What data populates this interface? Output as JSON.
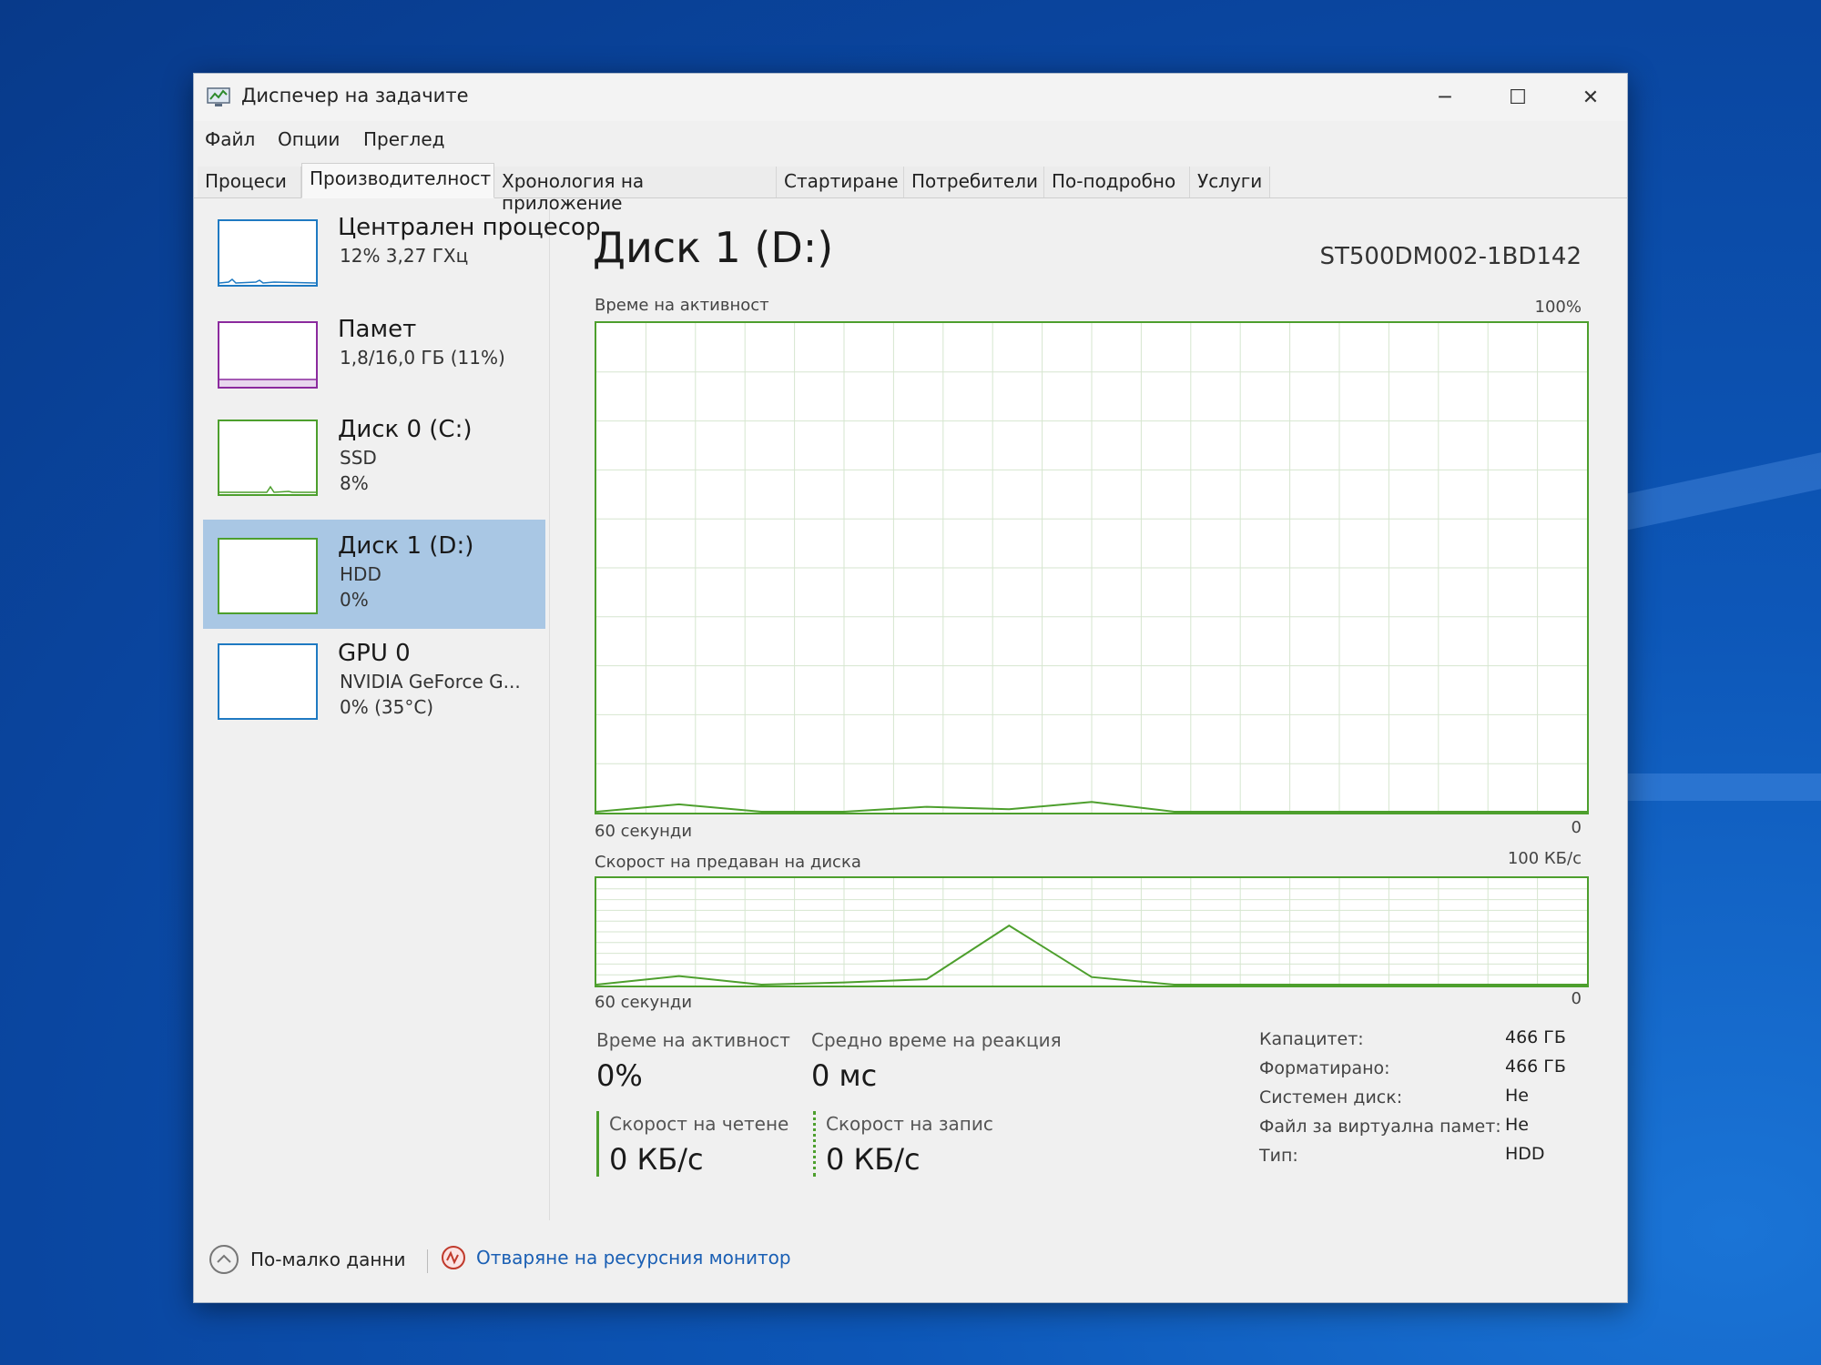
{
  "window": {
    "title": "Диспечер на задачите",
    "controls": {
      "minimize": "─",
      "maximize": "☐",
      "close": "✕"
    }
  },
  "menu": [
    "Файл",
    "Опции",
    "Преглед"
  ],
  "tabs": [
    "Процеси",
    "Производителност",
    "Хронология на приложение",
    "Стартиране",
    "Потребители",
    "По-подробно",
    "Услуги"
  ],
  "active_tab": "Производителност",
  "sidebar": {
    "items": [
      {
        "name": "Централен процеcор",
        "line1": "12% 3,27 ГХц",
        "line2": "",
        "color": "#1f7ac2"
      },
      {
        "name": "Памет",
        "line1": "1,8/16,0 ГБ (11%)",
        "line2": "",
        "color": "#8b2a9e"
      },
      {
        "name": "Диск 0 (C:)",
        "line1": "SSD",
        "line2": "8%",
        "color": "#4d9f2d"
      },
      {
        "name": "Диск 1 (D:)",
        "line1": "HDD",
        "line2": "0%",
        "color": "#4d9f2d"
      },
      {
        "name": "GPU 0",
        "line1": "NVIDIA GeForce G...",
        "line2": "0% (35°C)",
        "color": "#1f7ac2"
      }
    ],
    "selected_index": 3
  },
  "main": {
    "title": "Диск 1 (D:)",
    "model": "ST500DM002-1BD142",
    "activity_chart": {
      "label": "Време на активност",
      "max": "100%",
      "x_label": "60 секунди",
      "min": "0"
    },
    "transfer_chart": {
      "label": "Скорост на предаван на диска",
      "max": "100 КБ/с",
      "x_label": "60 секунди",
      "min": "0"
    },
    "stats": {
      "active_time_label": "Време на активност",
      "active_time_value": "0%",
      "response_label": "Средно време на реакция",
      "response_value": "0 мс",
      "read_label": "Скорост на четене",
      "read_value": "0 КБ/с",
      "write_label": "Скорост на запис",
      "write_value": "0 КБ/с"
    },
    "info": [
      {
        "label": "Капацитет:",
        "value": "466 ГБ"
      },
      {
        "label": "Форматирано:",
        "value": "466 ГБ"
      },
      {
        "label": "Системен диск:",
        "value": "Не"
      },
      {
        "label": "Файл за виртуална памет:",
        "value": "Не"
      },
      {
        "label": "Тип:",
        "value": "HDD"
      }
    ]
  },
  "footer": {
    "fewer_details": "По-малко данни",
    "open_monitor": "Отваряне на ресурсния монитор"
  },
  "chart_data": [
    {
      "type": "line",
      "title": "Време на активност",
      "x": [
        60,
        55,
        50,
        45,
        40,
        35,
        30,
        25,
        20,
        15,
        10,
        5,
        0
      ],
      "series": [
        {
          "values": [
            0,
            1.5,
            0,
            0,
            1,
            0.5,
            2,
            0,
            0,
            0,
            0,
            0,
            0
          ]
        }
      ],
      "ylim": [
        0,
        100
      ],
      "xlabel": "60 секунди"
    },
    {
      "type": "line",
      "title": "Скорост на предаван на диска",
      "x": [
        60,
        55,
        50,
        45,
        40,
        35,
        30,
        25,
        20,
        15,
        10,
        5,
        0
      ],
      "series": [
        {
          "values": [
            0,
            8,
            0,
            2,
            5,
            55,
            7,
            0,
            0,
            0,
            0,
            0,
            0
          ]
        }
      ],
      "ylim": [
        0,
        100
      ],
      "xlabel": "60 секунди"
    }
  ]
}
